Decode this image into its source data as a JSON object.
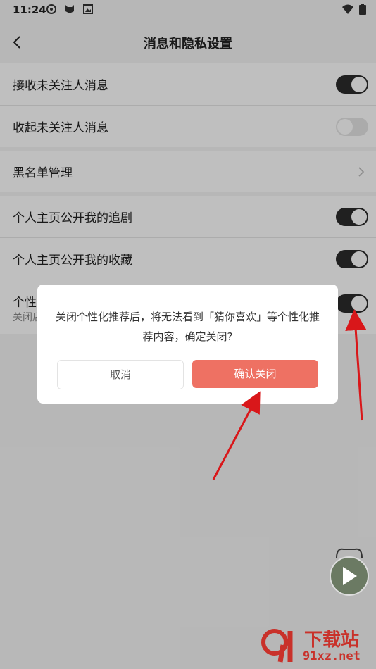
{
  "status_bar": {
    "time": "11:24"
  },
  "header": {
    "title": "消息和隐私设置"
  },
  "groups": {
    "messages": [
      {
        "label": "接收未关注人消息",
        "toggle": "on"
      },
      {
        "label": "收起未关注人消息",
        "toggle": "off"
      }
    ],
    "blacklist": {
      "label": "黑名单管理"
    },
    "privacy": [
      {
        "label": "个人主页公开我的追剧",
        "toggle": "on"
      },
      {
        "label": "个人主页公开我的收藏",
        "toggle": "on"
      },
      {
        "label": "个性",
        "sub": "关闭后",
        "toggle": "on"
      }
    ]
  },
  "dialog": {
    "message": "关闭个性化推荐后，将无法看到「猜你喜欢」等个性化推荐内容，确定关闭?",
    "cancel_label": "取消",
    "confirm_label": "确认关闭"
  },
  "watermark": {
    "site": "下载站",
    "domain": "91xz.net"
  },
  "colors": {
    "accent": "#ee7163",
    "toggle_on": "#2b2b2b",
    "annotation_arrow": "#d9171a"
  }
}
